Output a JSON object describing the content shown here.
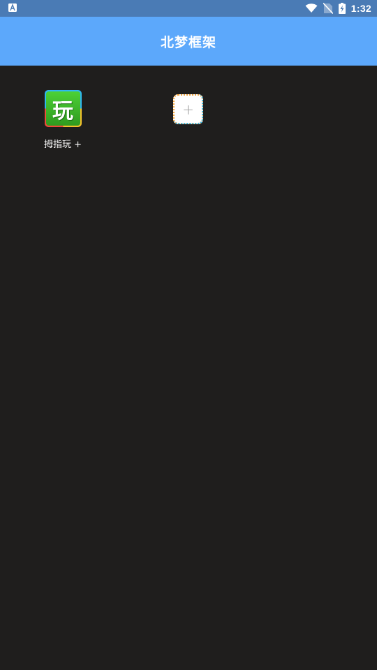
{
  "status_bar": {
    "notification_icon": "a-letter-notification-icon",
    "wifi_icon": "wifi-icon",
    "signal_icon": "no-sim-signal-icon",
    "battery_icon": "battery-charging-icon",
    "time": "1:32"
  },
  "app_bar": {
    "title": "北梦框架"
  },
  "apps": [
    {
      "icon_glyph": "玩",
      "label": "拇指玩 +"
    }
  ],
  "add_button": {
    "icon": "+"
  },
  "colors": {
    "status_bar": "#4a7bb5",
    "app_bar": "#5ca8fb",
    "background": "#1f1e1d",
    "app_icon_green": "#3fbf2c"
  }
}
